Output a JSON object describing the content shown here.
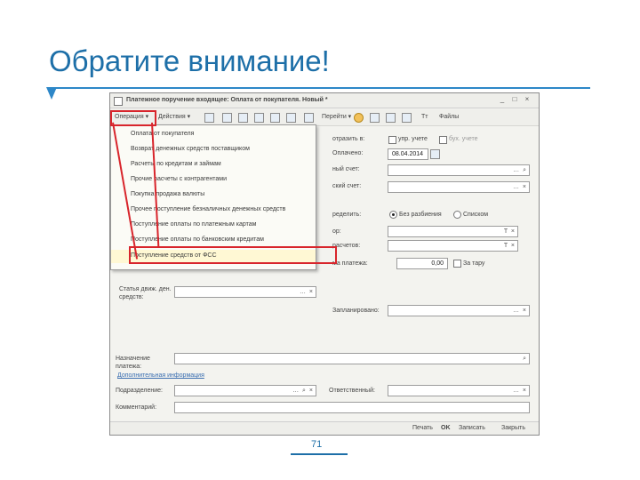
{
  "slide": {
    "title": "Обратите внимание!",
    "page_number": "71"
  },
  "window": {
    "title": "Платежное поручение входящее: Оплата от покупателя. Новый *"
  },
  "toolbar": {
    "operation": "Операция ▾",
    "actions": "Действия ▾",
    "goto": "Перейти ▾",
    "files": "Файлы"
  },
  "menu": {
    "items": [
      "Оплата от покупателя",
      "Возврат денежных средств поставщиком",
      "Расчеты по кредитам и займам",
      "Прочие расчеты с контрагентами",
      "Покупка продажа валюты",
      "Прочее поступление безналичных денежных средств",
      "Поступление оплаты по платежным картам",
      "Поступление оплаты по банковским кредитам",
      "Поступление средств от ФСС"
    ]
  },
  "form": {
    "reflect_label": "отразить в:",
    "tax_account": "упр. учете",
    "bu_account": "бух. учете",
    "paid_label": "Оплачено:",
    "paid_value": "08.04.2014",
    "org_account_label": "ный счет:",
    "bank_account_label": "ский счет:",
    "distribution_label": "ределить:",
    "without_distribution": "Без разбиения",
    "list": "Списком",
    "contract_label": "ор:",
    "settlements_label": "расчетов:",
    "amount_label": "ма платежа:",
    "amount_value": "0,00",
    "for_tare": "За тару",
    "cashflow_label": "Статья движ. ден. средств:",
    "planned_label": "Запланировано:",
    "purpose_label": "Назначение платежа:",
    "extra_link": "Дополнительная информация",
    "department_label": "Подразделение:",
    "responsible_label": "Ответственный:",
    "comment_label": "Комментарий:"
  },
  "statusbar": {
    "print": "Печать",
    "ok": "OK",
    "save": "Записать",
    "close": "Закрыть"
  }
}
